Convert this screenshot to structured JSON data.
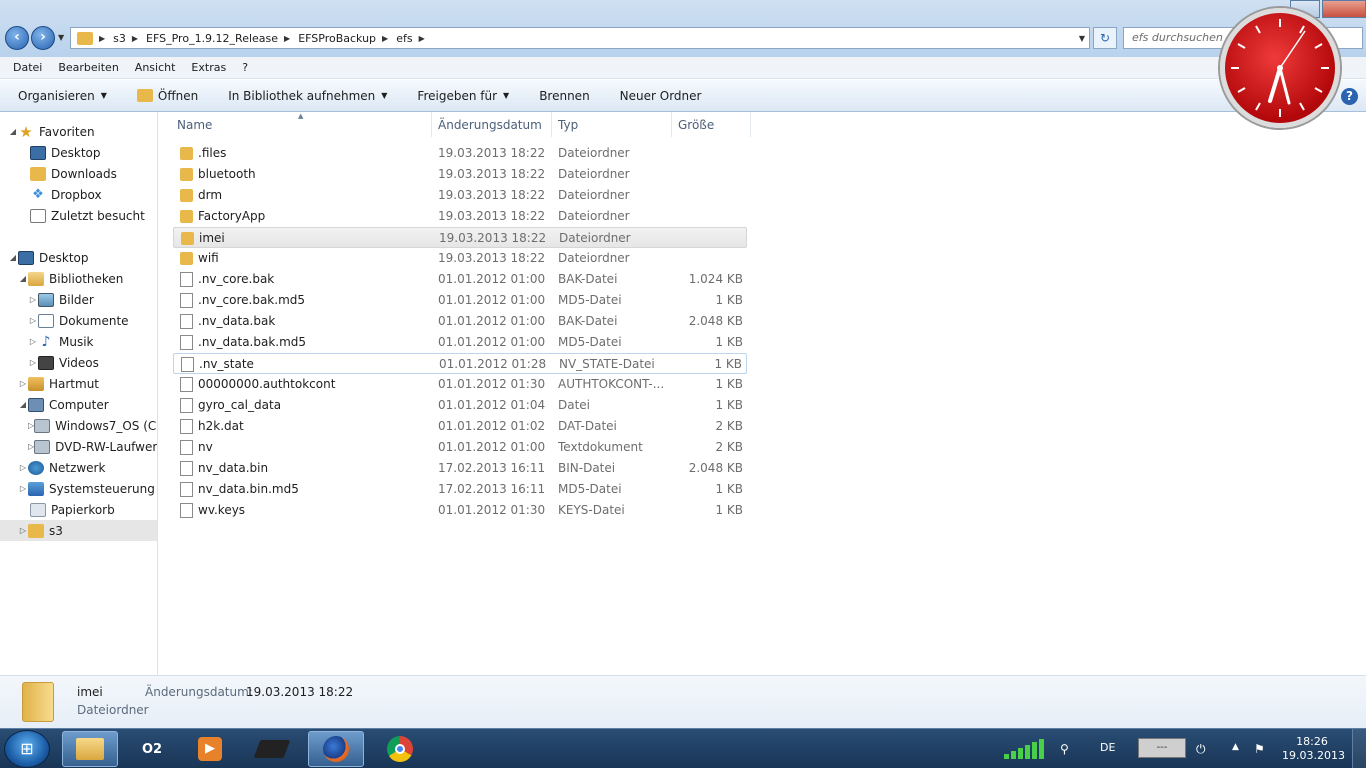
{
  "address": {
    "crumbs": [
      "s3",
      "EFS_Pro_1.9.12_Release",
      "EFSProBackup",
      "efs"
    ],
    "search_placeholder": "efs durchsuchen"
  },
  "menu": [
    "Datei",
    "Bearbeiten",
    "Ansicht",
    "Extras",
    "?"
  ],
  "toolbar": {
    "organize": "Organisieren",
    "open": "Öffnen",
    "library": "In Bibliothek aufnehmen",
    "share": "Freigeben für",
    "burn": "Brennen",
    "new_folder": "Neuer Ordner"
  },
  "nav": {
    "favorites": "Favoriten",
    "fav_desktop": "Desktop",
    "fav_downloads": "Downloads",
    "fav_dropbox": "Dropbox",
    "fav_recent": "Zuletzt besucht",
    "desktop": "Desktop",
    "libraries": "Bibliotheken",
    "pictures": "Bilder",
    "documents": "Dokumente",
    "music": "Musik",
    "videos": "Videos",
    "user": "Hartmut",
    "computer": "Computer",
    "drive_c": "Windows7_OS (C:)",
    "drive_dvd": "DVD-RW-Laufwerk",
    "network": "Netzwerk",
    "control_panel": "Systemsteuerung",
    "recycle": "Papierkorb",
    "s3": "s3"
  },
  "columns": {
    "name": "Name",
    "date": "Änderungsdatum",
    "type": "Typ",
    "size": "Größe"
  },
  "files": [
    {
      "name": ".files",
      "date": "19.03.2013 18:22",
      "type": "Dateiordner",
      "size": ""
    },
    {
      "name": "bluetooth",
      "date": "19.03.2013 18:22",
      "type": "Dateiordner",
      "size": ""
    },
    {
      "name": "drm",
      "date": "19.03.2013 18:22",
      "type": "Dateiordner",
      "size": ""
    },
    {
      "name": "FactoryApp",
      "date": "19.03.2013 18:22",
      "type": "Dateiordner",
      "size": ""
    },
    {
      "name": "imei",
      "date": "19.03.2013 18:22",
      "type": "Dateiordner",
      "size": ""
    },
    {
      "name": "wifi",
      "date": "19.03.2013 18:22",
      "type": "Dateiordner",
      "size": ""
    },
    {
      "name": ".nv_core.bak",
      "date": "01.01.2012 01:00",
      "type": "BAK-Datei",
      "size": "1.024 KB"
    },
    {
      "name": ".nv_core.bak.md5",
      "date": "01.01.2012 01:00",
      "type": "MD5-Datei",
      "size": "1 KB"
    },
    {
      "name": ".nv_data.bak",
      "date": "01.01.2012 01:00",
      "type": "BAK-Datei",
      "size": "2.048 KB"
    },
    {
      "name": ".nv_data.bak.md5",
      "date": "01.01.2012 01:00",
      "type": "MD5-Datei",
      "size": "1 KB"
    },
    {
      "name": ".nv_state",
      "date": "01.01.2012 01:28",
      "type": "NV_STATE-Datei",
      "size": "1 KB"
    },
    {
      "name": "00000000.authtokcont",
      "date": "01.01.2012 01:30",
      "type": "AUTHTOKCONT-...",
      "size": "1 KB"
    },
    {
      "name": "gyro_cal_data",
      "date": "01.01.2012 01:04",
      "type": "Datei",
      "size": "1 KB"
    },
    {
      "name": "h2k.dat",
      "date": "01.01.2012 01:02",
      "type": "DAT-Datei",
      "size": "2 KB"
    },
    {
      "name": "nv",
      "date": "01.01.2012 01:00",
      "type": "Textdokument",
      "size": "2 KB"
    },
    {
      "name": "nv_data.bin",
      "date": "17.02.2013 16:11",
      "type": "BIN-Datei",
      "size": "2.048 KB"
    },
    {
      "name": "nv_data.bin.md5",
      "date": "17.02.2013 16:11",
      "type": "MD5-Datei",
      "size": "1 KB"
    },
    {
      "name": "wv.keys",
      "date": "01.01.2012 01:30",
      "type": "KEYS-Datei",
      "size": "1 KB"
    }
  ],
  "details": {
    "name": "imei",
    "date_label": "Änderungsdatum:",
    "date": "19.03.2013 18:22",
    "type": "Dateiordner"
  },
  "taskbar": {
    "o2_label": "O2",
    "lang": "DE",
    "battery_text": "---",
    "time": "18:26",
    "date": "19.03.2013"
  }
}
